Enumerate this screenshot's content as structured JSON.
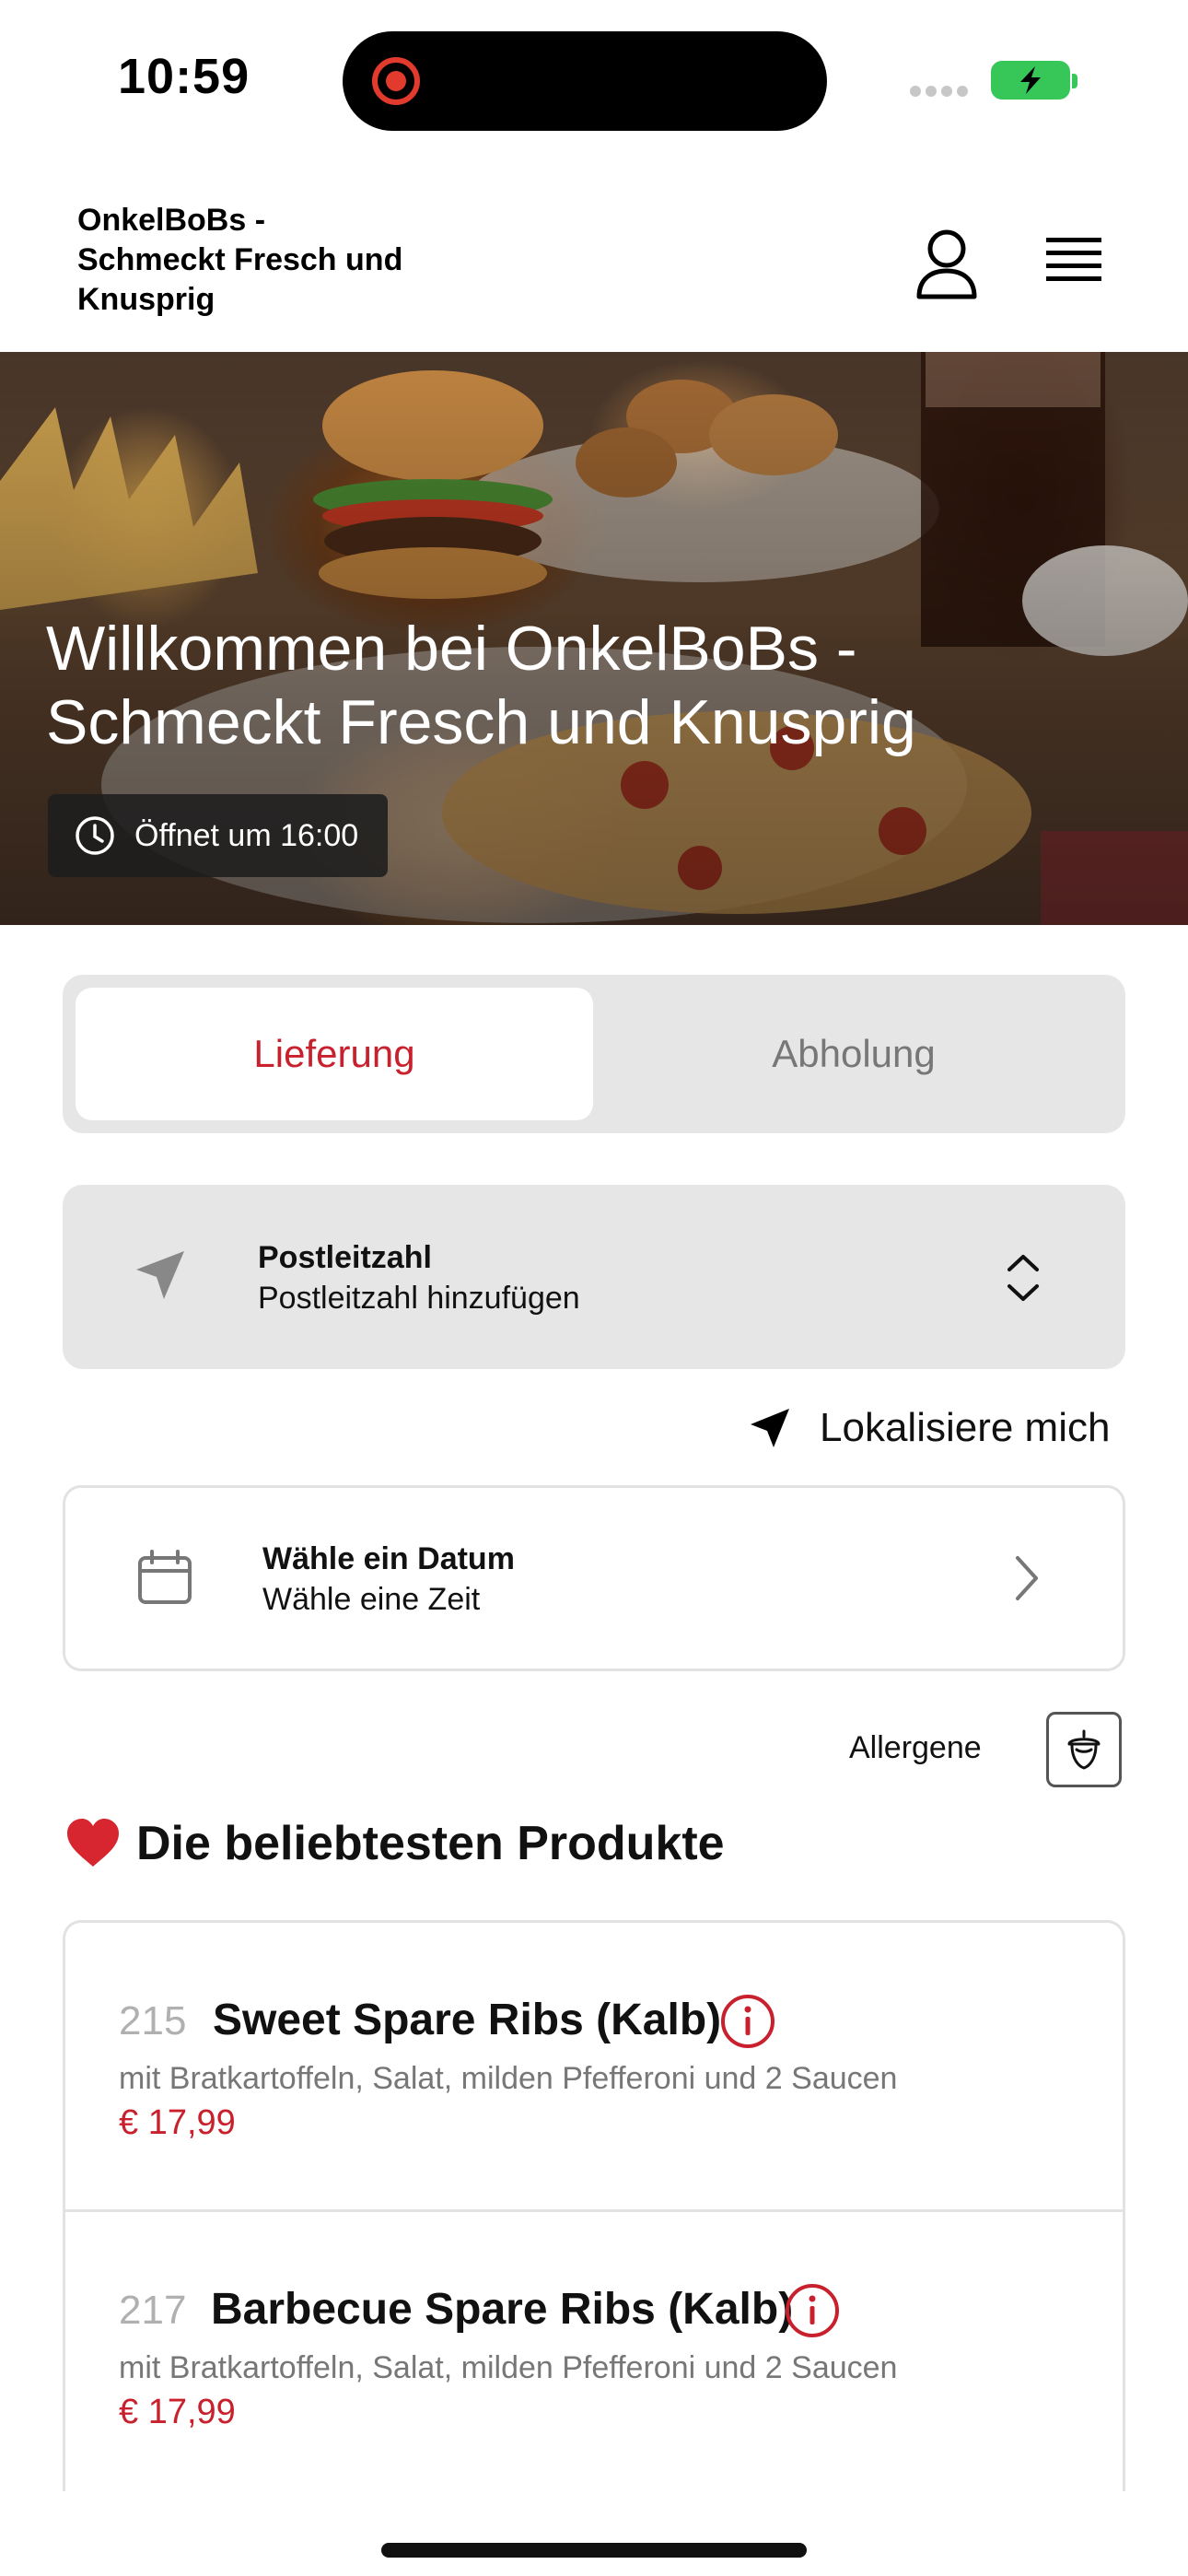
{
  "status_bar": {
    "time": "10:59"
  },
  "header": {
    "brand": "OnkelBoBs - Schmeckt Fresch und Knusprig"
  },
  "hero": {
    "title": "Willkommen bei  OnkelBoBs - Schmeckt Fresch und Knusprig",
    "opening": "Öffnet um 16:00"
  },
  "order_mode": {
    "options": [
      "Lieferung",
      "Abholung"
    ],
    "selected": "Lieferung"
  },
  "postcode": {
    "title": "Postleitzahl",
    "placeholder": "Postleitzahl hinzufügen"
  },
  "locate_label": "Lokalisiere mich",
  "schedule": {
    "title": "Wähle ein Datum",
    "subtitle": "Wähle eine Zeit"
  },
  "allergens_label": "Allergene",
  "section": {
    "icon": "heart-icon",
    "title": "Die beliebtesten Produkte"
  },
  "products": [
    {
      "number": "215",
      "name": "Sweet Spare Ribs (Kalb)",
      "description": "mit Bratkartoffeln, Salat, milden Pfefferoni und 2 Saucen",
      "price": "€ 17,99"
    },
    {
      "number": "217",
      "name": "Barbecue Spare Ribs (Kalb)",
      "description": "mit Bratkartoffeln, Salat, milden Pfefferoni und 2 Saucen",
      "price": "€ 17,99"
    }
  ],
  "colors": {
    "accent": "#c8202d",
    "panel": "#e6e6e6",
    "battery": "#37c759"
  }
}
